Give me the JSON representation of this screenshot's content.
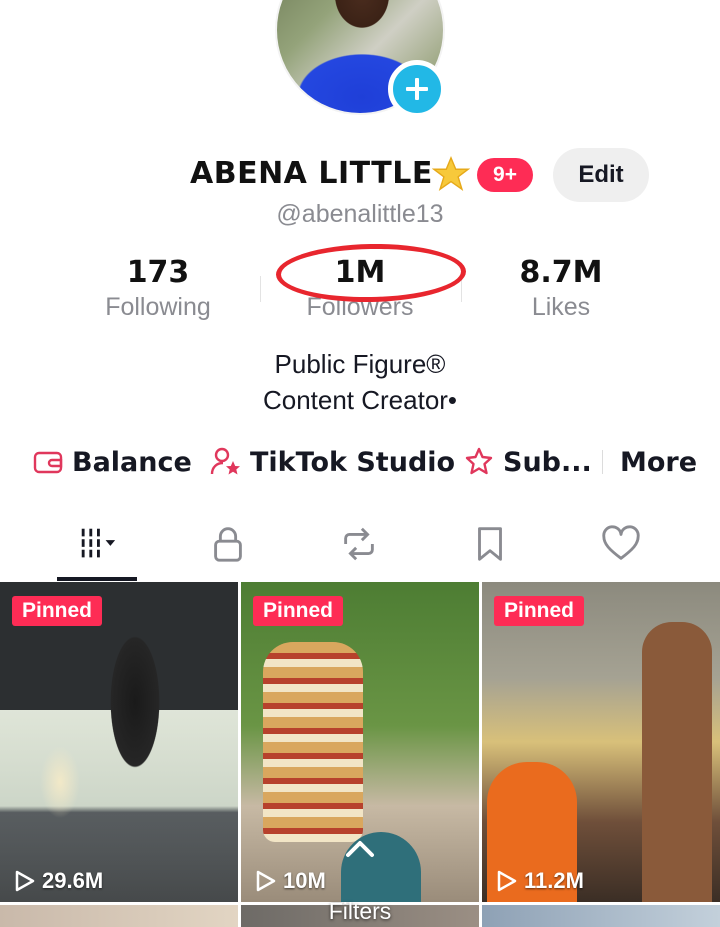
{
  "profile": {
    "display_name": "ABENA LITTLE",
    "badge_count": "9+",
    "edit_label": "Edit",
    "username": "@abenalittle13"
  },
  "stats": {
    "following": {
      "value": "173",
      "label": "Following"
    },
    "followers": {
      "value": "1M",
      "label": "Followers"
    },
    "likes": {
      "value": "8.7M",
      "label": "Likes"
    }
  },
  "bio": {
    "line1": "Public Figure®",
    "line2": "Content Creator•"
  },
  "actions": {
    "balance": "Balance",
    "studio": "TikTok Studio",
    "sub": "Sub...",
    "more": "More"
  },
  "tabs": [
    "videos-grid-icon",
    "lock-icon",
    "repost-icon",
    "bookmark-icon",
    "heart-icon"
  ],
  "videos": [
    {
      "tag": "Pinned",
      "views": "29.6M"
    },
    {
      "tag": "Pinned",
      "views": "10M"
    },
    {
      "tag": "Pinned",
      "views": "11.2M"
    }
  ],
  "filters": {
    "label": "Filters"
  },
  "colors": {
    "accent": "#fe2c55",
    "plus_badge": "#22b8e6",
    "highlight_ring": "#e8262e"
  }
}
